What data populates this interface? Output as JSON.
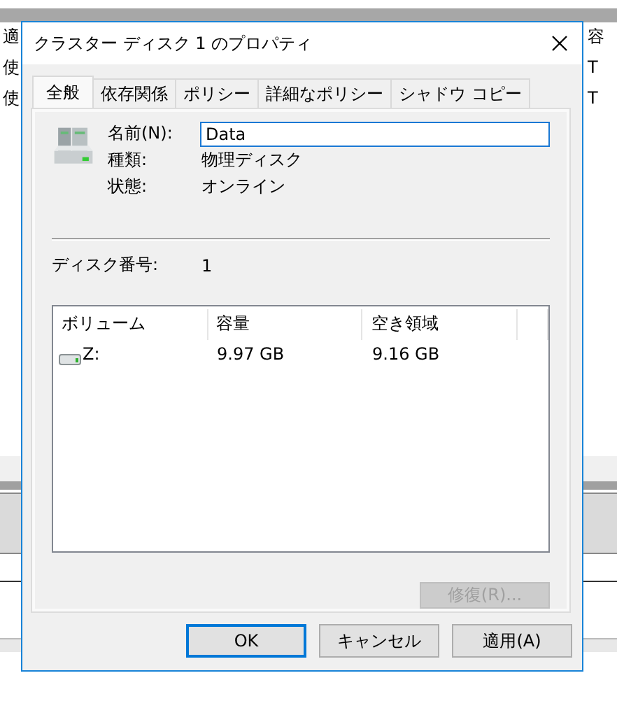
{
  "background_window": {
    "left_texts": [
      "適",
      "使",
      "使"
    ],
    "right_texts": [
      "容",
      "T",
      "T"
    ]
  },
  "dialog": {
    "title": "クラスター ディスク 1 のプロパティ"
  },
  "tabs": [
    {
      "label": "全般",
      "selected": true
    },
    {
      "label": "依存関係",
      "selected": false
    },
    {
      "label": "ポリシー",
      "selected": false
    },
    {
      "label": "詳細なポリシー",
      "selected": false
    },
    {
      "label": "シャドウ コピー",
      "selected": false
    }
  ],
  "fields": [
    {
      "label": "名前(N):",
      "kind": "input",
      "value": "Data"
    },
    {
      "label": "種類:",
      "kind": "text",
      "value": "物理ディスク"
    },
    {
      "label": "状態:",
      "kind": "text",
      "value": "オンライン"
    }
  ],
  "disk_number": {
    "label": "ディスク番号:",
    "value": "1"
  },
  "volumes": {
    "columns": [
      "ボリューム",
      "容量",
      "空き領域"
    ],
    "rows": [
      {
        "cells": [
          "Z:",
          "9.97 GB",
          "9.16 GB"
        ]
      }
    ]
  },
  "repair_button": {
    "label": "修復(R)...",
    "disabled": true
  },
  "buttons": [
    {
      "label": "OK",
      "default": true
    },
    {
      "label": "キャンセル",
      "default": false
    },
    {
      "label": "適用(A)",
      "default": false
    }
  ]
}
